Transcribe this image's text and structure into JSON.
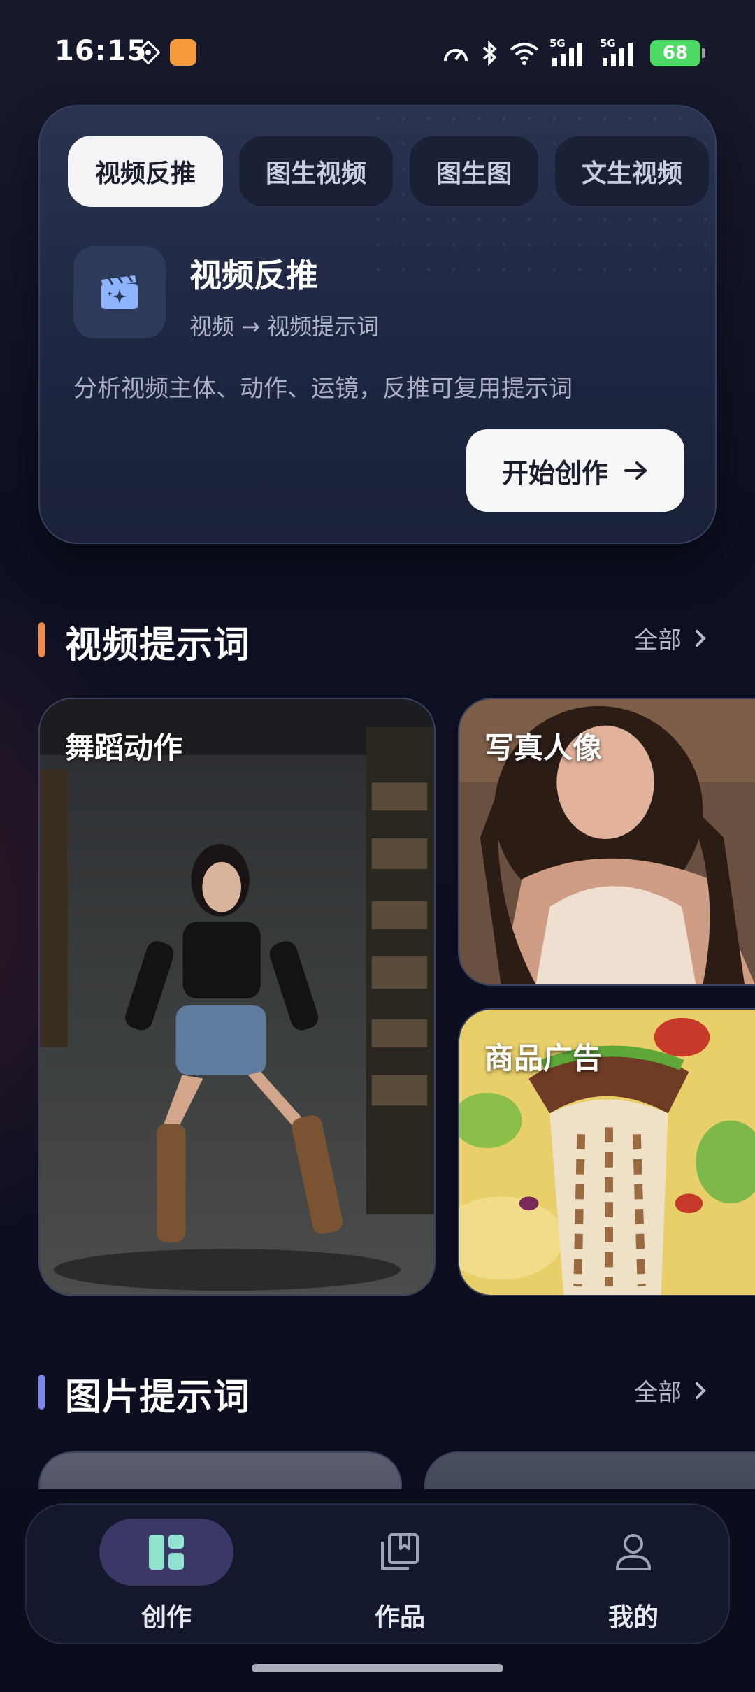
{
  "status_bar": {
    "time": "16:15",
    "network_1": "5G",
    "network_2": "5G",
    "battery": "68"
  },
  "hero": {
    "tabs": [
      {
        "label": "视频反推",
        "active": true
      },
      {
        "label": "图生视频",
        "active": false
      },
      {
        "label": "图生图",
        "active": false
      },
      {
        "label": "文生视频",
        "active": false
      }
    ],
    "feature_icon": "video-sparkle-icon",
    "feature_title": "视频反推",
    "feature_subtitle": "视频 → 视频提示词",
    "feature_description": "分析视频主体、动作、运镜，反推可复用提示词",
    "start_button": "开始创作"
  },
  "video_prompts": {
    "title": "视频提示词",
    "accent": "#f08a4b",
    "see_all": "全部",
    "cards": [
      {
        "label": "舞蹈动作",
        "image": "dancing-woman-photo"
      },
      {
        "label": "写真人像",
        "image": "portrait-woman-photo"
      },
      {
        "label": "商品广告",
        "image": "food-wrap-photo"
      }
    ]
  },
  "image_prompts": {
    "title": "图片提示词",
    "accent": "#7b86f0",
    "see_all": "全部"
  },
  "bottom_nav": {
    "items": [
      {
        "label": "创作",
        "icon": "dashboard-icon",
        "active": true
      },
      {
        "label": "作品",
        "icon": "bookmark-book-icon",
        "active": false
      },
      {
        "label": "我的",
        "icon": "user-icon",
        "active": false
      }
    ]
  }
}
